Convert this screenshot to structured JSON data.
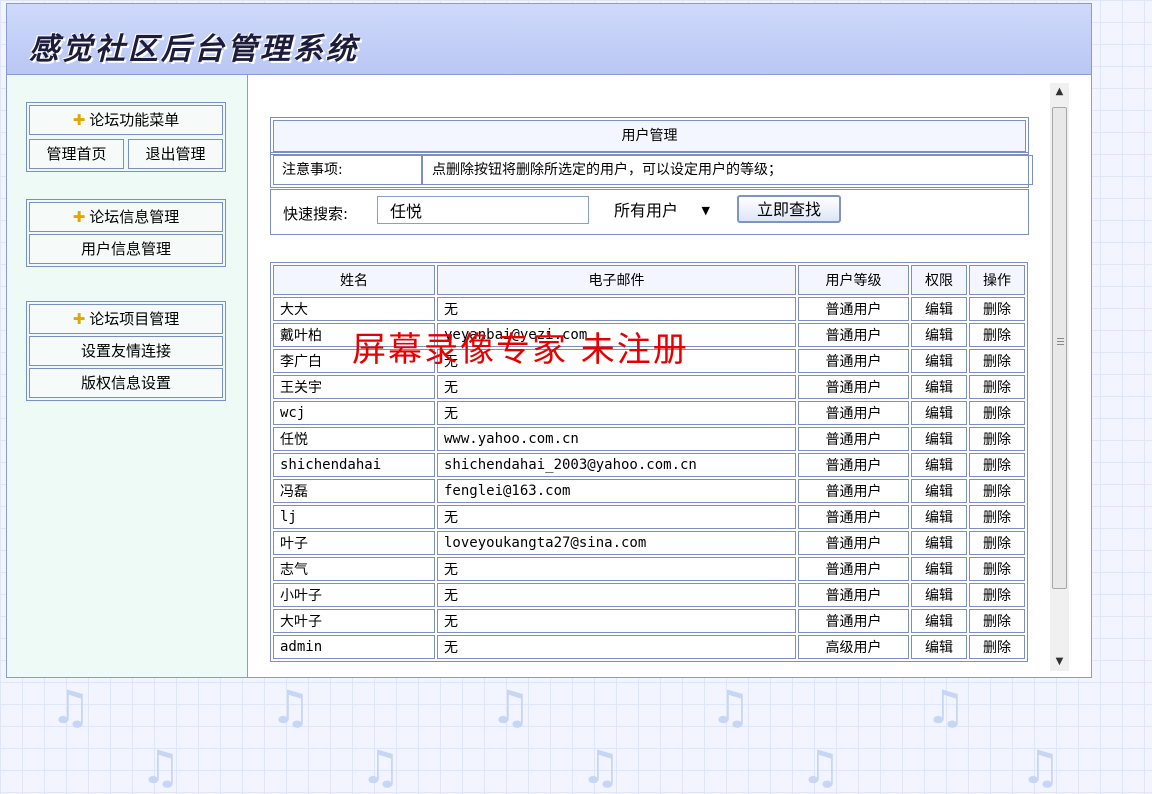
{
  "header": {
    "title": "感觉社区后台管理系统"
  },
  "sidebar": {
    "blocks": [
      {
        "title": "论坛功能菜单",
        "items": [
          "管理首页",
          "退出管理"
        ]
      },
      {
        "title": "论坛信息管理",
        "items": [
          "用户信息管理"
        ]
      },
      {
        "title": "论坛项目管理",
        "items": [
          "设置友情连接",
          "版权信息设置"
        ]
      }
    ]
  },
  "main": {
    "box_title": "用户管理",
    "notice_label": "注意事项:",
    "notice_text": "点删除按钮将删除所选定的用户，可以设定用户的等级；",
    "search_label": "快速搜索:",
    "search_value": "任悦",
    "filter_value": "所有用户",
    "search_button": "立即查找",
    "table": {
      "columns": [
        "姓名",
        "电子邮件",
        "用户等级",
        "权限",
        "操作"
      ],
      "rows": [
        {
          "name": "大大",
          "email": "无",
          "level": "普通用户",
          "perm": "编辑",
          "op": "删除"
        },
        {
          "name": "戴叶柏",
          "email": "yeyanbai@yezi.com",
          "level": "普通用户",
          "perm": "编辑",
          "op": "删除"
        },
        {
          "name": "李广白",
          "email": "无",
          "level": "普通用户",
          "perm": "编辑",
          "op": "删除"
        },
        {
          "name": "王关宇",
          "email": "无",
          "level": "普通用户",
          "perm": "编辑",
          "op": "删除"
        },
        {
          "name": "wcj",
          "email": "无",
          "level": "普通用户",
          "perm": "编辑",
          "op": "删除"
        },
        {
          "name": "任悦",
          "email": "www.yahoo.com.cn",
          "level": "普通用户",
          "perm": "编辑",
          "op": "删除"
        },
        {
          "name": "shichendahai",
          "email": "shichendahai_2003@yahoo.com.cn",
          "level": "普通用户",
          "perm": "编辑",
          "op": "删除"
        },
        {
          "name": "冯磊",
          "email": "fenglei@163.com",
          "level": "普通用户",
          "perm": "编辑",
          "op": "删除"
        },
        {
          "name": "lj",
          "email": "无",
          "level": "普通用户",
          "perm": "编辑",
          "op": "删除"
        },
        {
          "name": "叶子",
          "email": "loveyoukangta27@sina.com",
          "level": "普通用户",
          "perm": "编辑",
          "op": "删除"
        },
        {
          "name": "志气",
          "email": "无",
          "level": "普通用户",
          "perm": "编辑",
          "op": "删除"
        },
        {
          "name": "小叶子",
          "email": "无",
          "level": "普通用户",
          "perm": "编辑",
          "op": "删除"
        },
        {
          "name": "大叶子",
          "email": "无",
          "level": "普通用户",
          "perm": "编辑",
          "op": "删除"
        },
        {
          "name": "admin",
          "email": "无",
          "level": "高级用户",
          "perm": "编辑",
          "op": "删除"
        }
      ]
    }
  },
  "watermark": "屏幕录像专家  未注册",
  "colors": {
    "header_bg": "#c4d0f7",
    "sidebar_bg": "#edfaf6",
    "border": "#7b8fc6",
    "watermark": "#e60000"
  },
  "icons": {
    "menu_head": "plus-icon",
    "dropdown": "caret-down-icon",
    "scroll_up": "arrow-up-icon",
    "scroll_down": "arrow-down-icon"
  }
}
